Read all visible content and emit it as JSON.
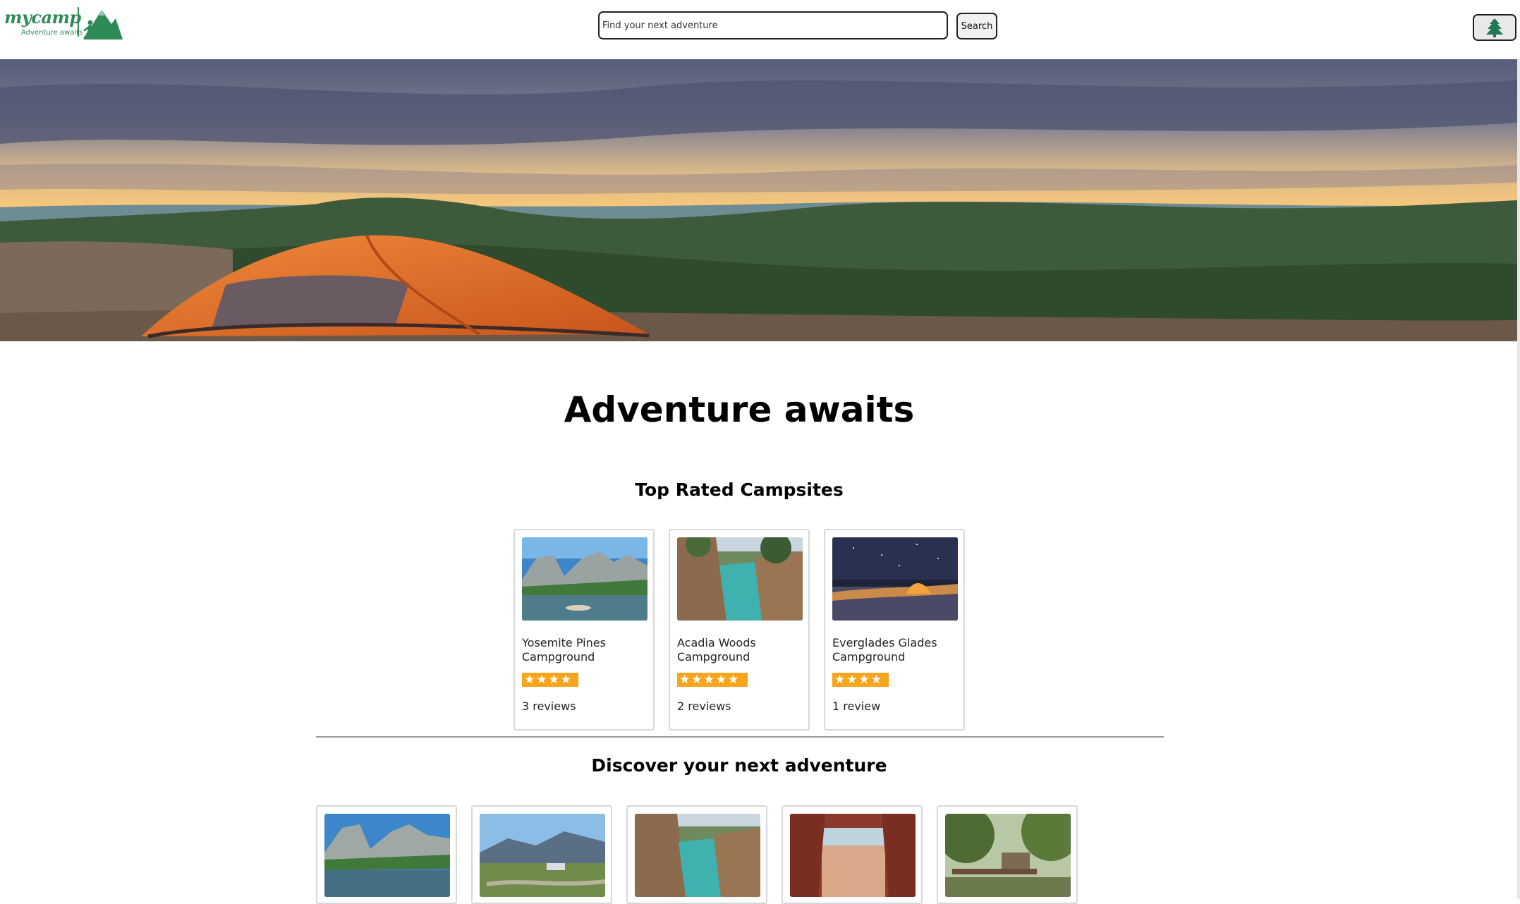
{
  "header": {
    "brand": "mycamp",
    "tagline": "Adventure awaits",
    "search_placeholder": "Find your next adventure",
    "search_value": "",
    "search_button": "Search",
    "menu_icon": "pine-tree-icon"
  },
  "hero": {
    "image": "tent-on-hilltop-at-sunset"
  },
  "main": {
    "title": "Adventure awaits",
    "top_rated": {
      "title": "Top Rated Campsites",
      "items": [
        {
          "name": "Yosemite Pines Campground",
          "rating": 4,
          "reviews": "3 reviews",
          "image": "yosemite-valley-river"
        },
        {
          "name": "Acadia Woods Campground",
          "rating": 4.5,
          "reviews": "2 reviews",
          "image": "coastal-cliffs-cove"
        },
        {
          "name": "Everglades Glades Campground",
          "rating": 4,
          "reviews": "1 review",
          "image": "tent-under-night-sky"
        }
      ]
    },
    "discover": {
      "title": "Discover your next adventure",
      "items": [
        {
          "image": "yosemite-valley-river"
        },
        {
          "image": "mountain-meadow-camp"
        },
        {
          "image": "coastal-cliffs-cove"
        },
        {
          "image": "red-rock-beach-view"
        },
        {
          "image": "forest-bridge-cabin"
        }
      ]
    }
  },
  "colors": {
    "brand_green": "#2e8b57",
    "star_orange": "#f7a51c"
  }
}
